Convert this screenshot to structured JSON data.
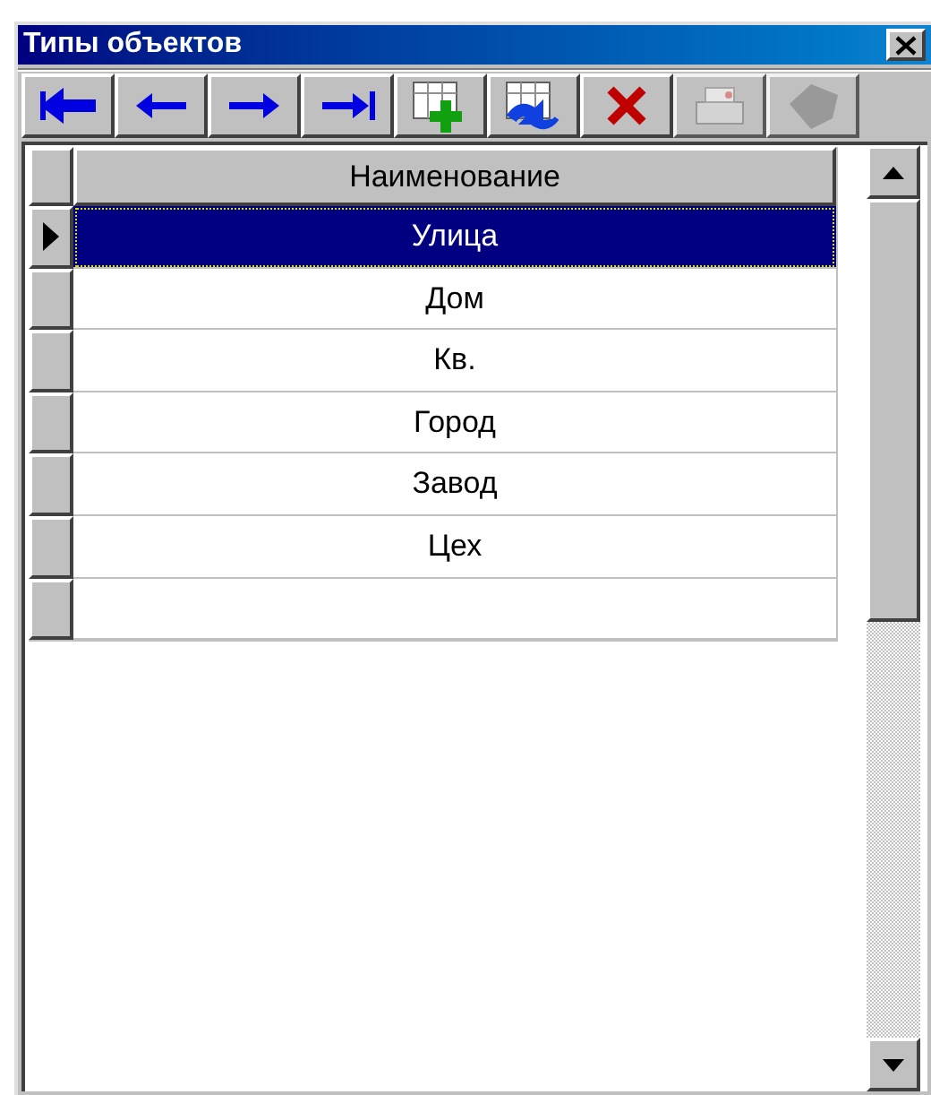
{
  "window": {
    "title": "Типы объектов"
  },
  "toolbar": [
    {
      "kind": "first",
      "disabled": false
    },
    {
      "kind": "prev",
      "disabled": false
    },
    {
      "kind": "next",
      "disabled": false
    },
    {
      "kind": "last",
      "disabled": false
    },
    {
      "kind": "insert",
      "disabled": false
    },
    {
      "kind": "refresh",
      "disabled": false
    },
    {
      "kind": "delete",
      "disabled": false
    },
    {
      "kind": "edit",
      "disabled": true
    },
    {
      "kind": "post",
      "disabled": true
    }
  ],
  "table": {
    "columns": [
      "Наименование"
    ],
    "rows": [
      {
        "name": "Улица",
        "selected": true
      },
      {
        "name": "Дом",
        "selected": false
      },
      {
        "name": "Кв.",
        "selected": false
      },
      {
        "name": "Город",
        "selected": false
      },
      {
        "name": "Завод",
        "selected": false
      },
      {
        "name": "Цех",
        "selected": false
      },
      {
        "selected": false
      }
    ]
  }
}
